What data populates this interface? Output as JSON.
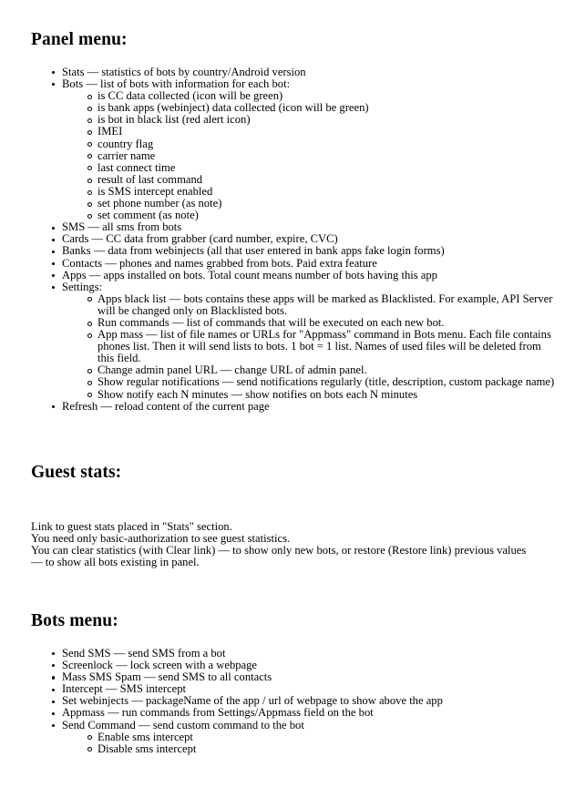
{
  "document": {
    "sections": [
      {
        "id": "panel-menu",
        "heading": "Panel menu:",
        "items": [
          {
            "text": "Stats — statistics of bots by country/Android version",
            "children": []
          },
          {
            "text": "Bots — list of bots with information for each bot:",
            "children": [
              "is CC data collected (icon will be green)",
              "is bank apps (webinject) data collected (icon will be green)",
              "is bot in black list (red alert icon)",
              "IMEI",
              "country flag",
              "carrier name",
              "last connect time",
              "result of last command",
              "is SMS intercept enabled",
              "set phone number (as note)",
              "set comment (as note)"
            ]
          },
          {
            "text": "SMS — all sms from bots",
            "children": []
          },
          {
            "text": "Cards — CC data from grabber (card number, expire, CVC)",
            "children": []
          },
          {
            "text": "Banks — data from webinjects (all that user entered in bank apps fake login forms)",
            "children": []
          },
          {
            "text": "Contacts — phones and names grabbed from bots. Paid extra feature",
            "children": []
          },
          {
            "text": "Apps — apps installed on bots. Total count means number of bots having this app",
            "children": []
          },
          {
            "text": "Settings:",
            "children": [
              "Apps black list — bots contains these apps will be marked as Blacklisted. For example, API Server will be changed only on Blacklisted bots.",
              "Run commands — list of commands that will be executed on each new bot.",
              "App mass — list of file names or URLs for \"Appmass\" command in Bots menu. Each file contains phones list. Then it will send lists to bots. 1 bot = 1 list. Names of used files will be deleted from this field.",
              "Change admin panel URL — change URL of admin panel.",
              "Show regular notifications — send notifications regularly (title, description, custom package name)",
              "Show notify each N minutes — show notifies on bots each N minutes"
            ]
          },
          {
            "text": "Refresh — reload content of the current page",
            "children": []
          }
        ]
      },
      {
        "id": "guest-stats",
        "heading": "Guest stats:",
        "paragraph_lines": [
          "Link to guest stats placed in \"Stats\" section.",
          "You need only basic-authorization to see guest statistics.",
          "You can clear statistics (with Clear link) — to show only new bots, or restore (Restore link) previous values — to show all bots existing in panel."
        ]
      },
      {
        "id": "bots-menu",
        "heading": "Bots menu:",
        "items": [
          {
            "text": "Send SMS — send SMS from a bot",
            "children": []
          },
          {
            "text": "Screenlock — lock screen with a webpage",
            "children": []
          },
          {
            "text": "Mass SMS Spam — send SMS to all contacts",
            "children": []
          },
          {
            "text": "Intercept — SMS intercept",
            "children": []
          },
          {
            "text": "Set webinjects — packageName of the app / url of webpage to show above the app",
            "children": []
          },
          {
            "text": "Appmass — run commands from Settings/Appmass field on the bot",
            "children": []
          },
          {
            "text": "Send Command — send custom command to the bot",
            "children": [
              "Enable sms intercept",
              "Disable sms intercept"
            ]
          }
        ]
      }
    ]
  },
  "style": {
    "text_color": "#000000",
    "background_color": "#ffffff"
  }
}
